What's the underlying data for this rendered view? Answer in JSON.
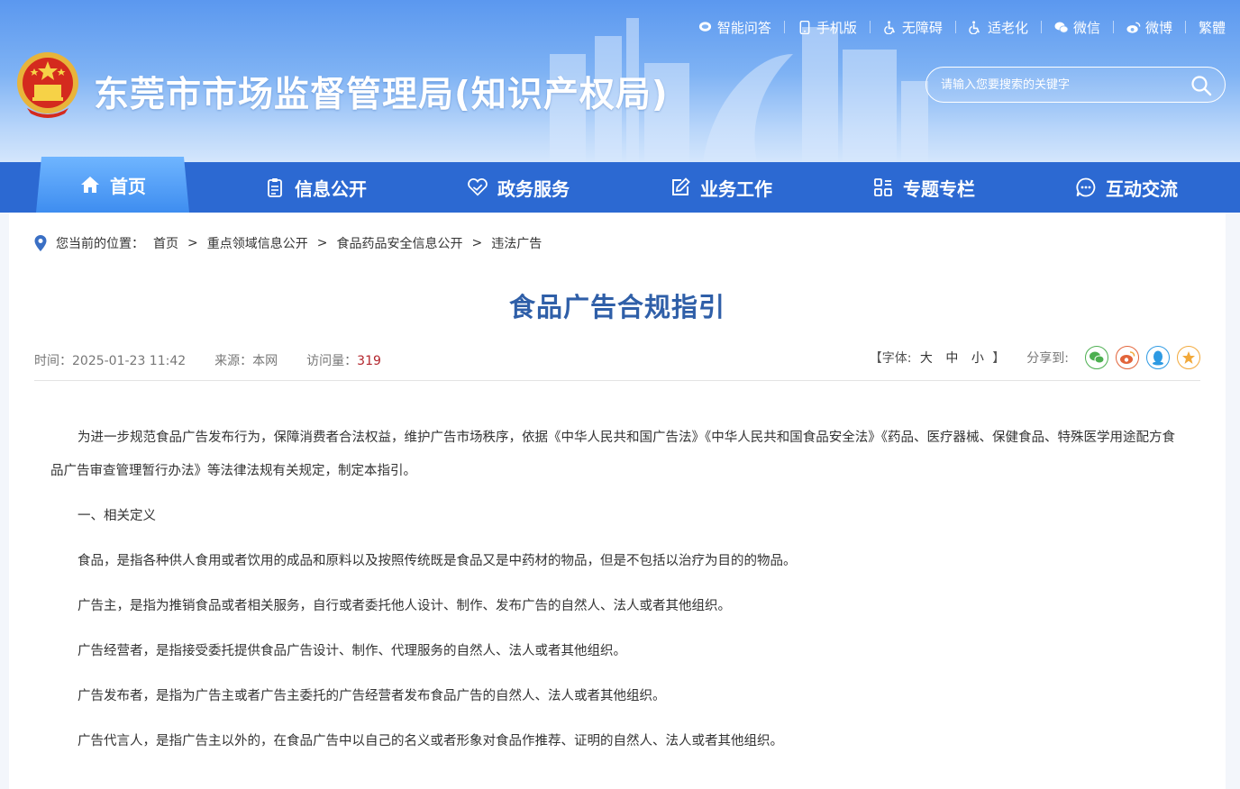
{
  "header": {
    "site_title": "东莞市市场监督管理局(知识产权局)",
    "toplinks": [
      {
        "label": "智能问答",
        "icon": "chat-bubble-icon"
      },
      {
        "label": "手机版",
        "icon": "mobile-icon"
      },
      {
        "label": "无障碍",
        "icon": "wheelchair-icon"
      },
      {
        "label": "适老化",
        "icon": "elderly-icon"
      },
      {
        "label": "微信",
        "icon": "wechat-icon"
      },
      {
        "label": "微博",
        "icon": "weibo-icon"
      },
      {
        "label": "繁體",
        "icon": ""
      }
    ],
    "search_placeholder": "请输入您要搜索的关键字"
  },
  "nav": {
    "items": [
      {
        "label": "首页",
        "icon": "home-icon",
        "active": true
      },
      {
        "label": "信息公开",
        "icon": "clipboard-icon"
      },
      {
        "label": "政务服务",
        "icon": "heart-handshake-icon"
      },
      {
        "label": "业务工作",
        "icon": "edit-icon"
      },
      {
        "label": "专题专栏",
        "icon": "grid-icon"
      },
      {
        "label": "互动交流",
        "icon": "chat-dots-icon"
      }
    ]
  },
  "breadcrumb": {
    "label": "您当前的位置：",
    "items": [
      "首页",
      "重点领域信息公开",
      "食品药品安全信息公开",
      "违法广告"
    ],
    "separator": ">"
  },
  "article": {
    "title": "食品广告合规指引",
    "time_label": "时间：",
    "time": "2025-01-23 11:42",
    "source_label": "来源：",
    "source": "本网",
    "visits_label": "访问量：",
    "visits": "319",
    "font_open": "【字体:",
    "font_large": "大",
    "font_medium": "中",
    "font_small": "小",
    "font_close": "】",
    "share_label": "分享到:",
    "paragraphs": [
      "为进一步规范食品广告发布行为，保障消费者合法权益，维护广告市场秩序，依据《中华人民共和国广告法》《中华人民共和国食品安全法》《药品、医疗器械、保健食品、特殊医学用途配方食品广告审查管理暂行办法》等法律法规有关规定，制定本指引。",
      "一、相关定义",
      "食品，是指各种供人食用或者饮用的成品和原料以及按照传统既是食品又是中药材的物品，但是不包括以治疗为目的的物品。",
      "广告主，是指为推销食品或者相关服务，自行或者委托他人设计、制作、发布广告的自然人、法人或者其他组织。",
      "广告经营者，是指接受委托提供食品广告设计、制作、代理服务的自然人、法人或者其他组织。",
      "广告发布者，是指为广告主或者广告主委托的广告经营者发布食品广告的自然人、法人或者其他组织。",
      "广告代言人，是指广告主以外的，在食品广告中以自己的名义或者形象对食品作推荐、证明的自然人、法人或者其他组织。"
    ]
  },
  "colors": {
    "nav_bg": "#2c69d2",
    "title_blue": "#2f5fa8",
    "visits_red": "#b3262d",
    "wechat_green": "#4caf50",
    "weibo_orange": "#e2643a",
    "qq_blue": "#2d9ae3",
    "favorite_yellow": "#f2a93b"
  }
}
